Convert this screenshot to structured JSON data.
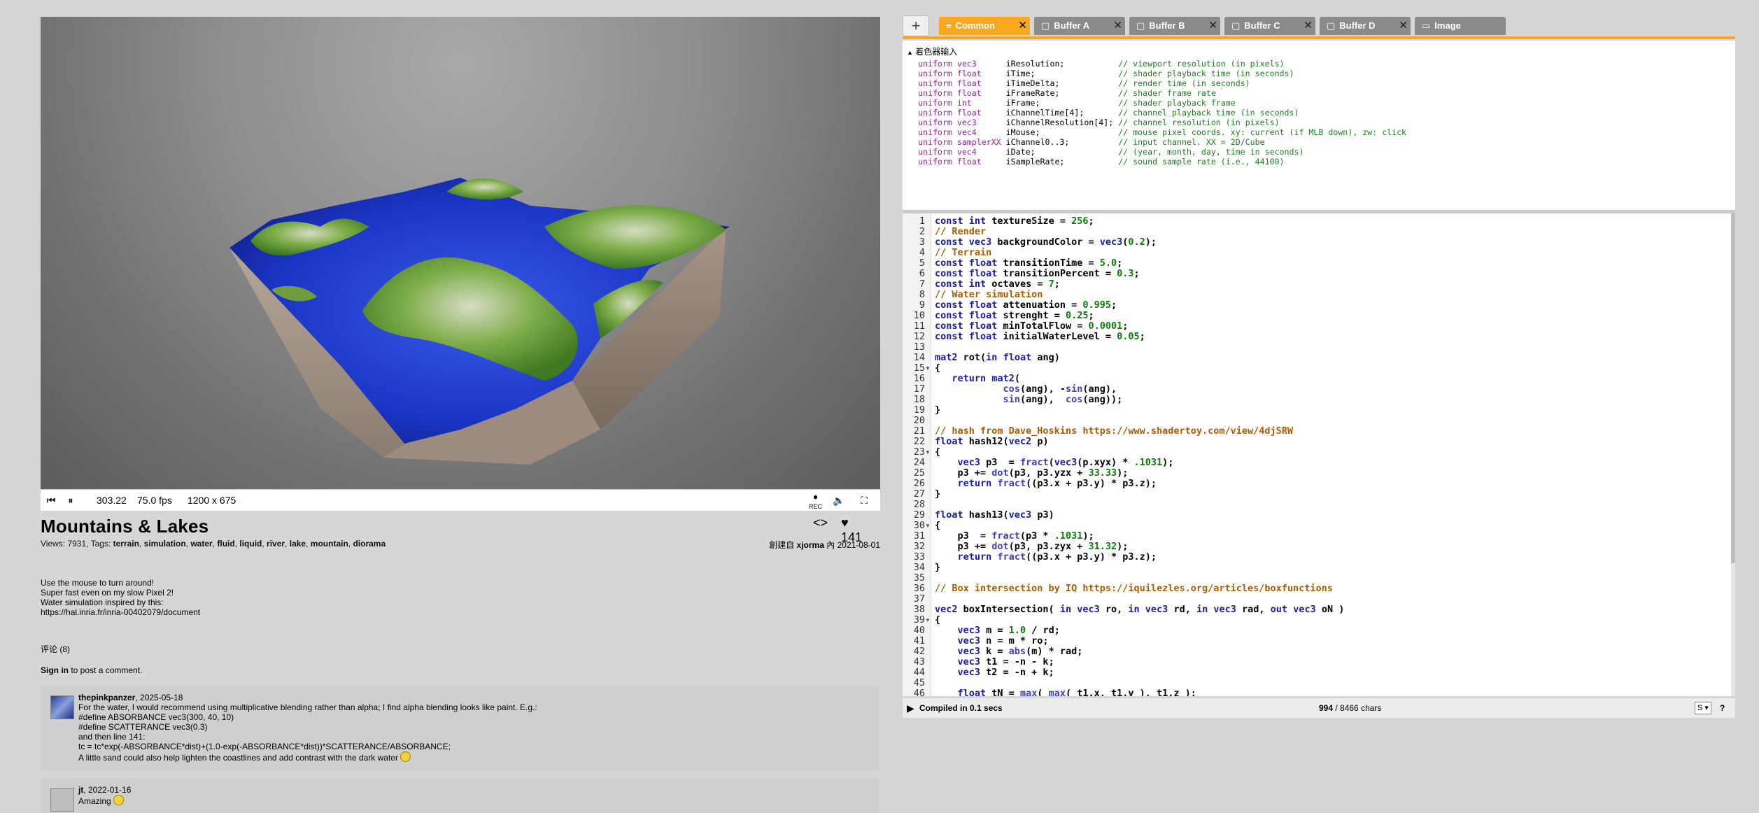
{
  "player": {
    "time": "303.22",
    "fps": "75.0 fps",
    "resolution": "1200 x 675",
    "rec_label": "REC"
  },
  "info": {
    "title": "Mountains & Lakes",
    "views_prefix": "Views: 7931, Tags: ",
    "tags": [
      "terrain",
      "simulation",
      "water",
      "fluid",
      "liquid",
      "river",
      "lake",
      "mountain",
      "diorama"
    ],
    "created_by_prefix": "創建自",
    "author": "xjorma",
    "created_in": "內",
    "date": "2021-08-01",
    "likes": "141",
    "description": [
      "Use the mouse to turn around!",
      "Super fast even on my slow Pixel 2!",
      "Water simulation inspired by this:",
      "https://hal.inria.fr/inria-00402079/document"
    ],
    "comments_label": "评论 (8)",
    "signin_link": "Sign in",
    "signin_rest": " to post a comment."
  },
  "comments": [
    {
      "user": "thepinkpanzer",
      "date": ", 2025-05-18",
      "lines": [
        "For the water, I would recommend using multiplicative blending rather than alpha; I find alpha blending looks like paint. E.g.:",
        "#define ABSORBANCE vec3(300, 40, 10)",
        "#define SCATTERANCE vec3(0.3)",
        "and then line 141:",
        "tc = tc*exp(-ABSORBANCE*dist)+(1.0-exp(-ABSORBANCE*dist))*SCATTERANCE/ABSORBANCE;",
        "A little sand could also help lighten the coastlines and add contrast with the dark water"
      ]
    },
    {
      "user": "jt",
      "date": ", 2022-01-16",
      "lines": [
        "Amazing"
      ]
    }
  ],
  "tabs": [
    {
      "label": "Common",
      "active": true,
      "icon": "lines-icon"
    },
    {
      "label": "Buffer A",
      "active": false,
      "icon": "buffer-icon"
    },
    {
      "label": "Buffer B",
      "active": false,
      "icon": "buffer-icon"
    },
    {
      "label": "Buffer C",
      "active": false,
      "icon": "buffer-icon"
    },
    {
      "label": "Buffer D",
      "active": false,
      "icon": "buffer-icon"
    },
    {
      "label": "Image",
      "active": false,
      "icon": "monitor-icon"
    }
  ],
  "uniforms": {
    "header": "着色器输入",
    "lines": [
      {
        "t": "uniform vec3     ",
        "n": " iResolution;           ",
        "c": "// viewport resolution (in pixels)"
      },
      {
        "t": "uniform float    ",
        "n": " iTime;                 ",
        "c": "// shader playback time (in seconds)"
      },
      {
        "t": "uniform float    ",
        "n": " iTimeDelta;            ",
        "c": "// render time (in seconds)"
      },
      {
        "t": "uniform float    ",
        "n": " iFrameRate;            ",
        "c": "// shader frame rate"
      },
      {
        "t": "uniform int      ",
        "n": " iFrame;                ",
        "c": "// shader playback frame"
      },
      {
        "t": "uniform float    ",
        "n": " iChannelTime[4];       ",
        "c": "// channel playback time (in seconds)"
      },
      {
        "t": "uniform vec3     ",
        "n": " iChannelResolution[4]; ",
        "c": "// channel resolution (in pixels)"
      },
      {
        "t": "uniform vec4     ",
        "n": " iMouse;                ",
        "c": "// mouse pixel coords. xy: current (if MLB down), zw: click"
      },
      {
        "t": "uniform samplerXX",
        "n": " iChannel0..3;          ",
        "c": "// input channel. XX = 2D/Cube"
      },
      {
        "t": "uniform vec4     ",
        "n": " iDate;                 ",
        "c": "// (year, month, day, time in seconds)"
      },
      {
        "t": "uniform float    ",
        "n": " iSampleRate;           ",
        "c": "// sound sample rate (i.e., 44100)"
      }
    ]
  },
  "code": [
    "const int textureSize = 256;",
    "// Render",
    "const vec3 backgroundColor = vec3(0.2);",
    "// Terrain",
    "const float transitionTime = 5.0;",
    "const float transitionPercent = 0.3;",
    "const int octaves = 7;",
    "// Water simulation",
    "const float attenuation = 0.995;",
    "const float strenght = 0.25;",
    "const float minTotalFlow = 0.0001;",
    "const float initialWaterLevel = 0.05;",
    "",
    "mat2 rot(in float ang)",
    "{",
    "   return mat2(",
    "            cos(ang), -sin(ang),",
    "            sin(ang),  cos(ang));",
    "}",
    "",
    "// hash from Dave_Hoskins https://www.shadertoy.com/view/4djSRW",
    "float hash12(vec2 p)",
    "{",
    "    vec3 p3  = fract(vec3(p.xyx) * .1031);",
    "    p3 += dot(p3, p3.yzx + 33.33);",
    "    return fract((p3.x + p3.y) * p3.z);",
    "}",
    "",
    "float hash13(vec3 p3)",
    "{",
    "    p3  = fract(p3 * .1031);",
    "    p3 += dot(p3, p3.zyx + 31.32);",
    "    return fract((p3.x + p3.y) * p3.z);",
    "}",
    "",
    "// Box intersection by IQ https://iquilezles.org/articles/boxfunctions",
    "",
    "vec2 boxIntersection( in vec3 ro, in vec3 rd, in vec3 rad, out vec3 oN )",
    "{",
    "    vec3 m = 1.0 / rd;",
    "    vec3 n = m * ro;",
    "    vec3 k = abs(m) * rad;",
    "    vec3 t1 = -n - k;",
    "    vec3 t2 = -n + k;",
    "",
    "    float tN = max( max( t1.x, t1.y ), t1.z );"
  ],
  "status": {
    "compiled": "Compiled in 0.1 secs",
    "chars_count": "994",
    "chars_rest": " / 8466 chars",
    "font_select": "S",
    "help": "?"
  },
  "colors": {
    "accent": "#f7a81e",
    "water": "#1a3ad6",
    "grass": "#5a8f2a"
  }
}
